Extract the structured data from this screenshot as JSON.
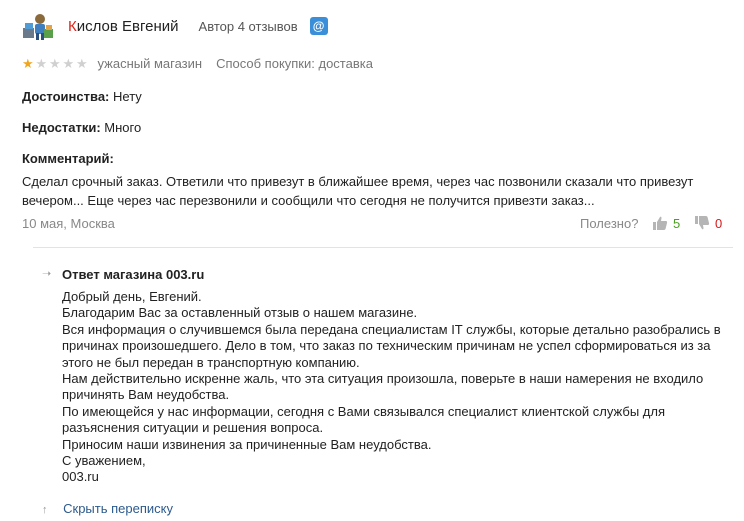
{
  "author": {
    "name": "Кислов Евгений",
    "meta": "Автор 4 отзывов",
    "email_icon": "@"
  },
  "review": {
    "rating": 1,
    "rating_max": 5,
    "rating_text": "ужасный магазин",
    "purchase_method": "Способ покупки: доставка",
    "pros_label": "Достоинства:",
    "pros_value": "Нету",
    "cons_label": "Недостатки:",
    "cons_value": "Много",
    "comment_label": "Комментарий:",
    "comment": "Сделал срочный заказ. Ответили что привезут в ближайшее время, через час позвонили сказали что привезут вечером... Еще через час перезвонили и сообщили что сегодня не получится привезти заказ...",
    "date_location": "10 мая, Москва",
    "useful_label": "Полезно?",
    "votes_up": "5",
    "votes_down": "0"
  },
  "reply": {
    "title": "Ответ магазина 003.ru",
    "lines": [
      "Добрый день, Евгений.",
      "Благодарим Вас за оставленный отзыв о нашем магазине.",
      "Вся информация о случившемся была передана специалистам IT службы, которые детально разобрались в причинах произошедшего. Дело в том, что заказ по техническим причинам не успел сформироваться из за этого не был передан в транспортную компанию.",
      "Нам действительно искренне жаль, что эта ситуация произошла, поверьте в наши намерения не входило причинять Вам неудобства.",
      "По имеющейся у нас информации, сегодня с Вами связывался специалист клиентской службы для разъяснения ситуации и решения вопроса.",
      "Приносим наши извинения за причиненные Вам неудобства.",
      "С уважением,",
      "003.ru"
    ],
    "hide_label": "Скрыть переписку"
  },
  "icons": {
    "avatar": "user-avatar-icon",
    "email": "email-icon",
    "star_on": "star-filled-icon",
    "star_off": "star-empty-icon",
    "thumb_up": "thumbs-up-icon",
    "thumb_down": "thumbs-down-icon",
    "arrow_right": "arrow-right-icon",
    "arrow_up": "arrow-up-icon"
  },
  "colors": {
    "star_on": "#f1a51c",
    "star_off": "#d0d0d0",
    "vote_up": "#4a9e21",
    "vote_down": "#d51b1b",
    "link": "#2c5a8c",
    "email_badge": "#3b8fd9"
  }
}
